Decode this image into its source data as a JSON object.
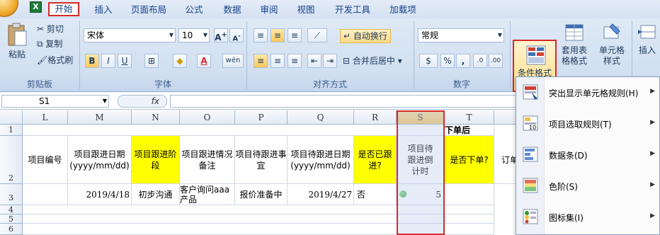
{
  "tabs": [
    "开始",
    "插入",
    "页面布局",
    "公式",
    "数据",
    "审阅",
    "视图",
    "开发工具",
    "加载项"
  ],
  "ribbon": {
    "clipboard": {
      "paste": "粘贴",
      "cut": "剪切",
      "copy": "复制",
      "format_painter": "格式刷",
      "label": "剪贴板"
    },
    "font": {
      "name": "宋体",
      "size": "10",
      "label": "字体",
      "bold": "B",
      "italic": "I",
      "underline": "U",
      "phonetic": "wén"
    },
    "alignment": {
      "wrap": "自动换行",
      "merge": "合并后居中",
      "label": "对齐方式"
    },
    "number": {
      "format": "常规",
      "label": "数字",
      "percent": "%",
      "comma": ","
    },
    "styles": {
      "conditional": "条件格式",
      "table": "套用表格格式",
      "cell": "单元格样式"
    },
    "cells": {
      "insert": "插入"
    }
  },
  "formula_bar": {
    "name_box": "S1",
    "fx": "fx"
  },
  "columns": [
    "L",
    "M",
    "N",
    "O",
    "P",
    "Q",
    "R",
    "S",
    "T"
  ],
  "rows": [
    "1",
    "2",
    "3",
    "4",
    "5",
    "6"
  ],
  "cells": {
    "t1": "下单后",
    "L2": "项目编号",
    "M2": "项目跟进日期(yyyy/mm/dd)",
    "N2": "项目跟进阶段",
    "O2": "项目跟进情况备注",
    "P2": "项目待跟进事宜",
    "Q2": "项目待跟进日期(yyyy/mm/dd)",
    "R2": "是否已跟进?",
    "S2": "项目待跟进倒计时",
    "T2": "是否下单?",
    "U2": "订单",
    "M3": "2019/4/18",
    "N3": "初步沟通",
    "O3": "客户询问aaa产品",
    "P3": "报价准备中",
    "Q3": "2019/4/27",
    "R3": "否",
    "S3": "5"
  },
  "cf_menu": [
    {
      "label": "突出显示单元格规则(H)",
      "icon": "highlight-rules-icon"
    },
    {
      "label": "项目选取规则(T)",
      "icon": "top-bottom-rules-icon"
    },
    {
      "label": "数据条(D)",
      "icon": "data-bars-icon"
    },
    {
      "label": "色阶(S)",
      "icon": "color-scales-icon"
    },
    {
      "label": "图标集(I)",
      "icon": "icon-sets-icon"
    }
  ],
  "colors": {
    "highlight": "#d72a2a",
    "yellow": "#ffff00",
    "ribbon": "#dfe9f5"
  }
}
